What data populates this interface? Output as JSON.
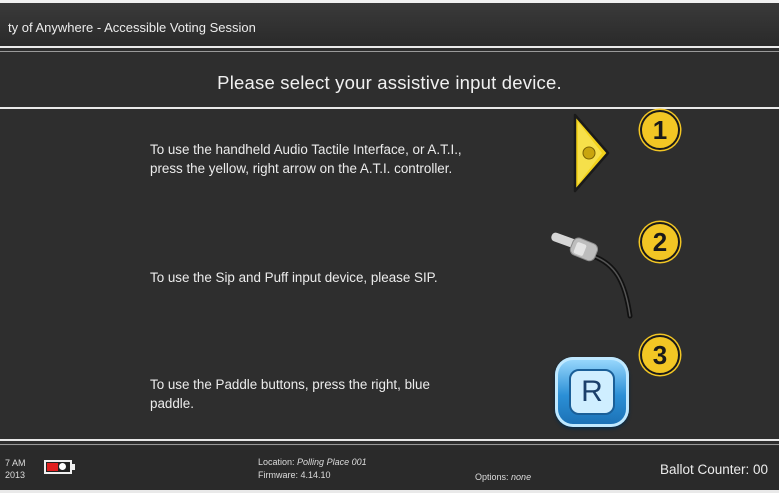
{
  "window": {
    "title": "ty of Anywhere - Accessible Voting Session"
  },
  "main": {
    "heading": "Please select your assistive input device.",
    "options": [
      {
        "number": "1",
        "line1": "To use the handheld Audio Tactile Interface, or A.T.I.,",
        "line2": "press the yellow, right arrow on the A.T.I. controller.",
        "icon": "yellow-right-arrow-icon"
      },
      {
        "number": "2",
        "line1": "To use the Sip and Puff input device, please SIP.",
        "icon": "sip-puff-tube-icon"
      },
      {
        "number": "3",
        "line1": "To use the Paddle buttons, press the right, blue",
        "line2": "paddle.",
        "icon": "blue-r-paddle-icon",
        "paddle_letter": "R"
      }
    ]
  },
  "footer": {
    "time": "7 AM",
    "date": "2013",
    "location_label": "Location:",
    "location_value": "Polling Place 001",
    "firmware_label": "Firmware:",
    "firmware_value": "4.14.10",
    "options_label": "Options:",
    "options_value": "none",
    "ballot_counter": "Ballot Counter: 00"
  },
  "colors": {
    "background": "#2e2e2e",
    "badge_yellow": "#f2c624",
    "paddle_blue": "#2b8fd6",
    "battery_red": "#e02020"
  }
}
